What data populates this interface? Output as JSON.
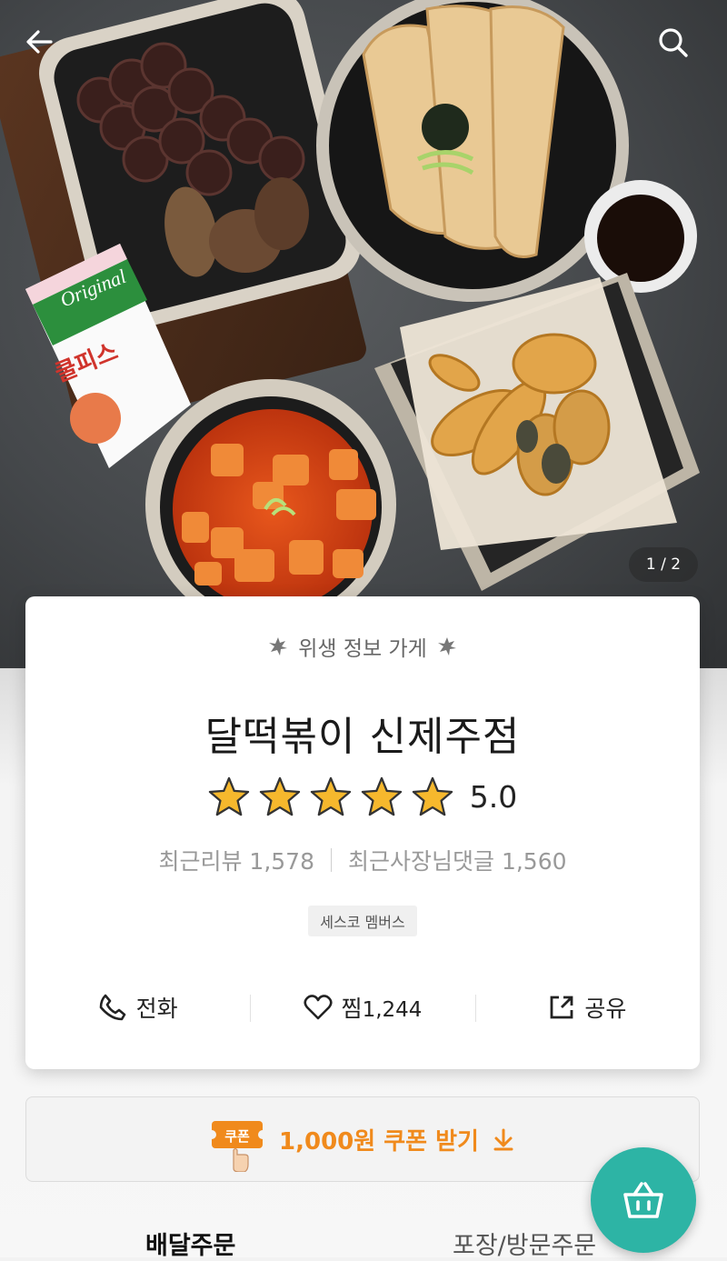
{
  "hero": {
    "page_indicator": "1 / 2",
    "milk_carton_brand": "Original",
    "milk_carton_product": "쿨피스"
  },
  "store": {
    "hygiene_label": "위생 정보 가게",
    "name": "달떡볶이 신제주점",
    "rating": "5.0",
    "stars_filled": 5,
    "stars_total": 5,
    "recent_reviews_label": "최근리뷰 1,578",
    "recent_owner_replies_label": "최근사장님댓글 1,560",
    "member_badge": "세스코 멤버스"
  },
  "actions": {
    "call_label": "전화",
    "like_label": "찜",
    "like_count": "1,244",
    "share_label": "공유"
  },
  "coupon": {
    "icon_text": "쿠폰",
    "label": "1,000원 쿠폰 받기"
  },
  "tabs": {
    "delivery": "배달주문",
    "pickup": "포장/방문주문"
  },
  "colors": {
    "accent_orange": "#f08a1c",
    "star_yellow": "#f6b82d",
    "cart_teal": "#2db4a5"
  },
  "icons": {
    "back": "arrow-left-icon",
    "search": "search-icon",
    "hygiene": "leaf-icon",
    "star": "star-icon",
    "call": "phone-icon",
    "like": "heart-icon",
    "share": "share-icon",
    "coupon_download": "download-arrow-icon",
    "cart": "basket-icon"
  }
}
